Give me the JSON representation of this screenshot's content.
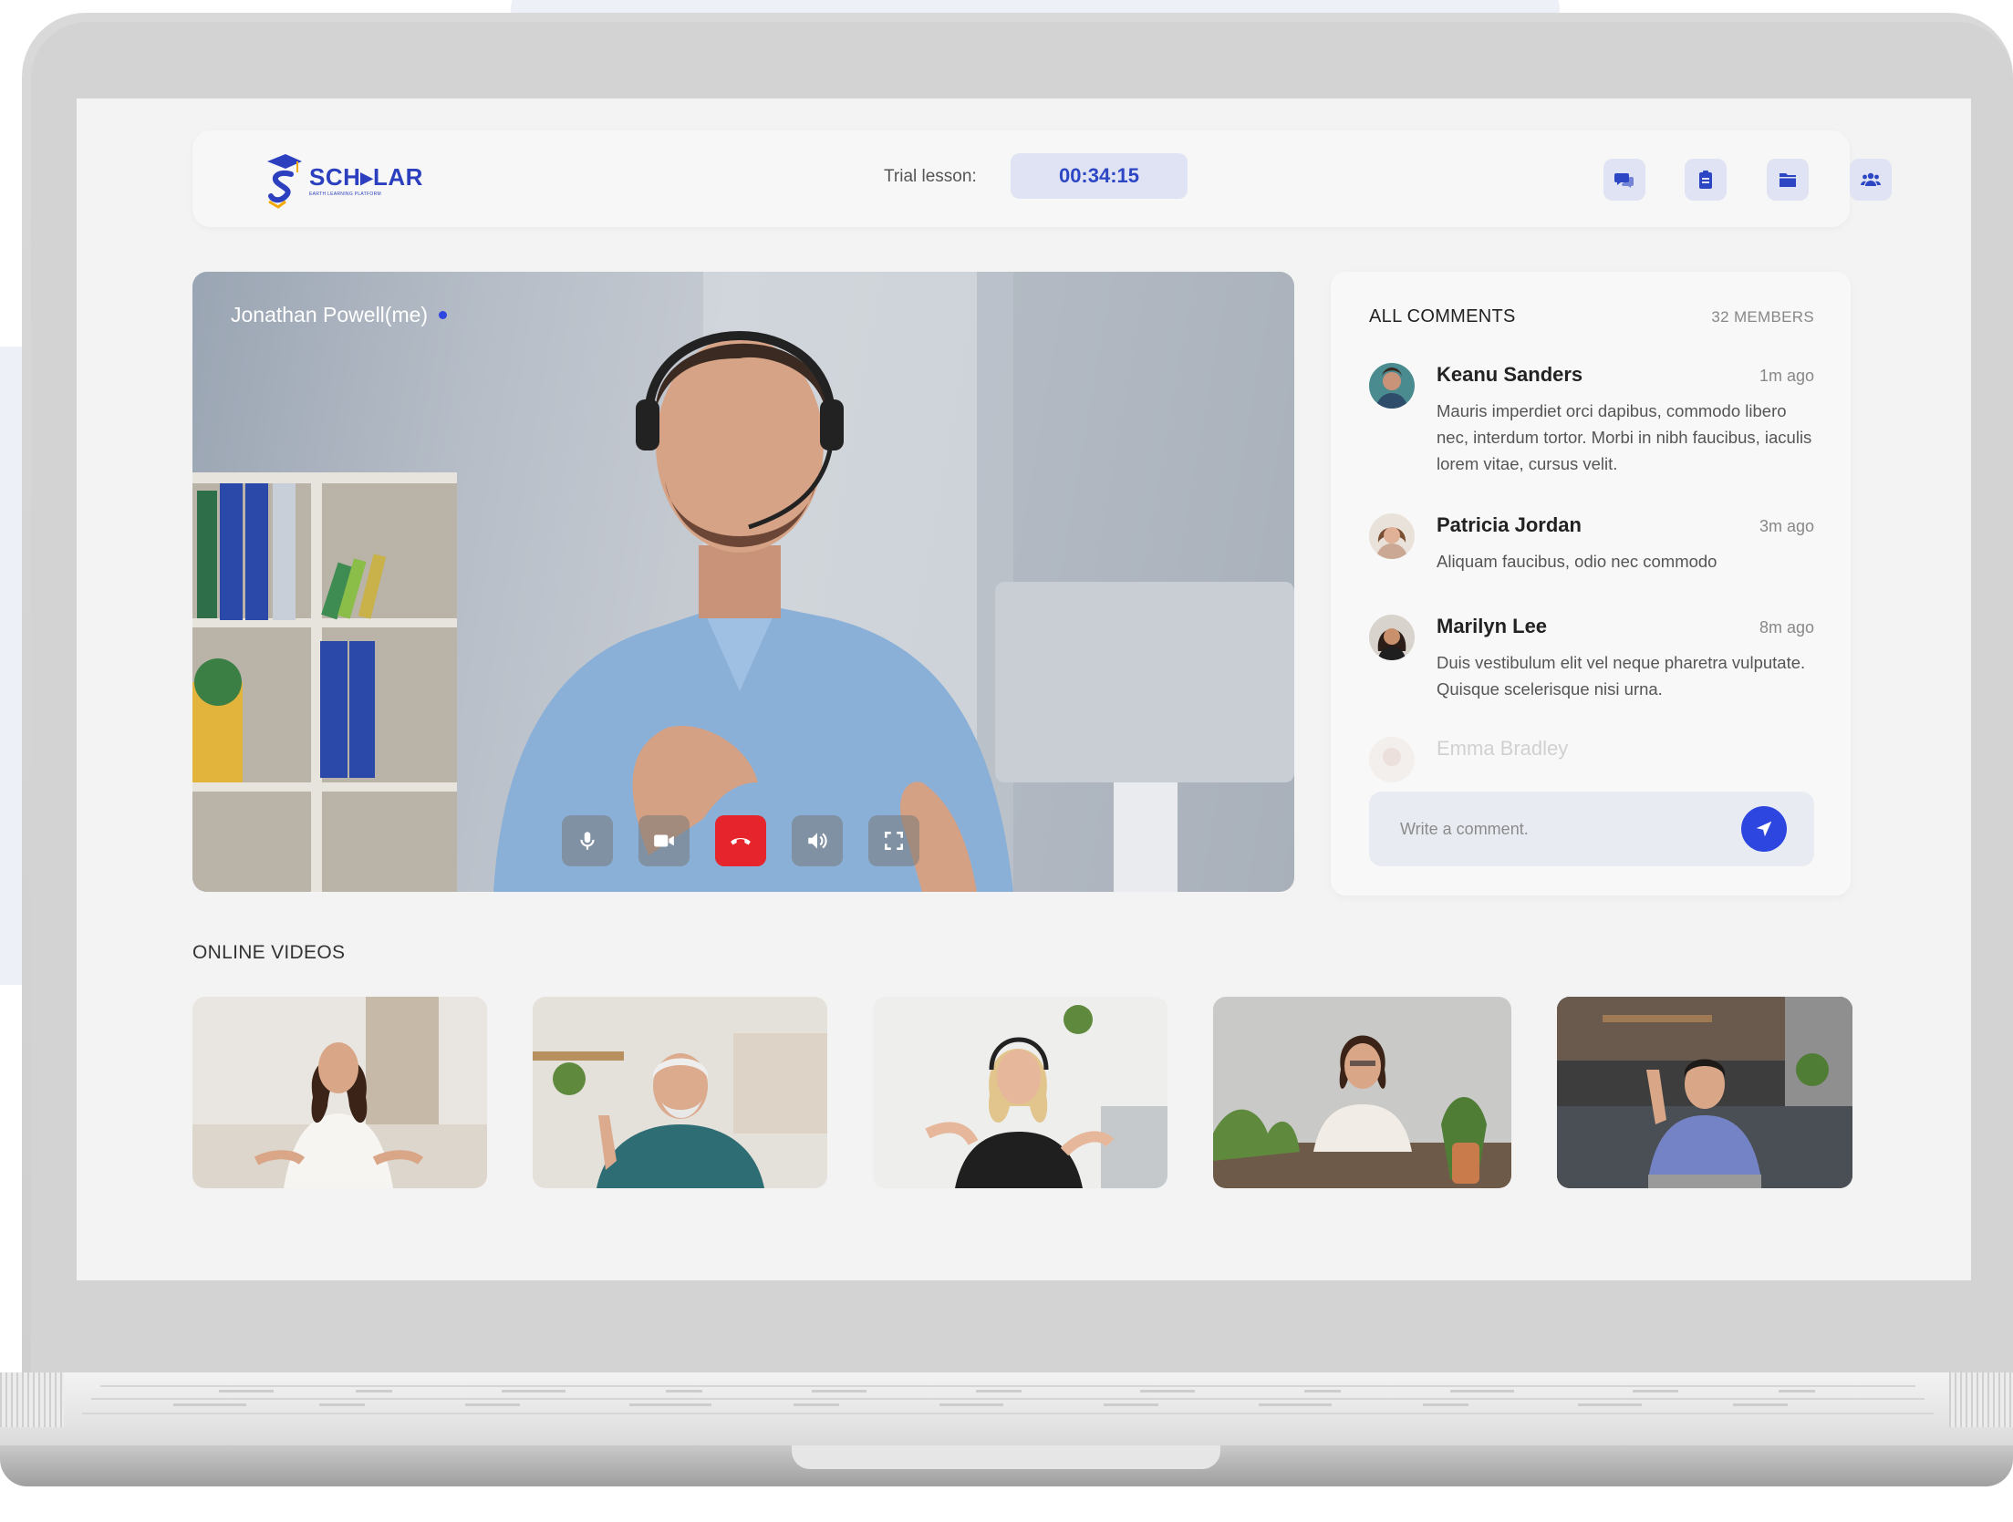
{
  "app": {
    "logo_text": "SCH▸LAR",
    "logo_tagline": "EARTH LEARNING PLATFORM"
  },
  "topbar": {
    "trial_label": "Trial lesson:",
    "timer": "00:34:15",
    "icons": [
      "chat-icon",
      "clipboard-icon",
      "folder-icon",
      "users-icon"
    ]
  },
  "video": {
    "participant_label": "Jonathan Powell(me)",
    "controls": [
      "microphone-icon",
      "camera-icon",
      "end-call-icon",
      "volume-icon",
      "fullscreen-icon"
    ]
  },
  "comments": {
    "title": "ALL COMMENTS",
    "members": "32 MEMBERS",
    "items": [
      {
        "name": "Keanu Sanders",
        "time": "1m ago",
        "text": "Mauris imperdiet orci dapibus, commodo libero nec, interdum tortor. Morbi in nibh faucibus, iaculis lorem vitae, cursus velit."
      },
      {
        "name": "Patricia Jordan",
        "time": "3m ago",
        "text": "Aliquam faucibus, odio nec commodo"
      },
      {
        "name": "Marilyn Lee",
        "time": "8m ago",
        "text": "Duis vestibulum elit vel neque pharetra vulputate. Quisque scelerisque nisi urna."
      },
      {
        "name": "Emma Bradley",
        "time": "",
        "text": ""
      }
    ],
    "input_placeholder": "Write a comment."
  },
  "online_videos": {
    "title": "ONLINE VIDEOS",
    "count": 5
  },
  "colors": {
    "accent": "#2d46e0",
    "end_call": "#e5242b",
    "timer_bg": "#dfe3f3"
  }
}
